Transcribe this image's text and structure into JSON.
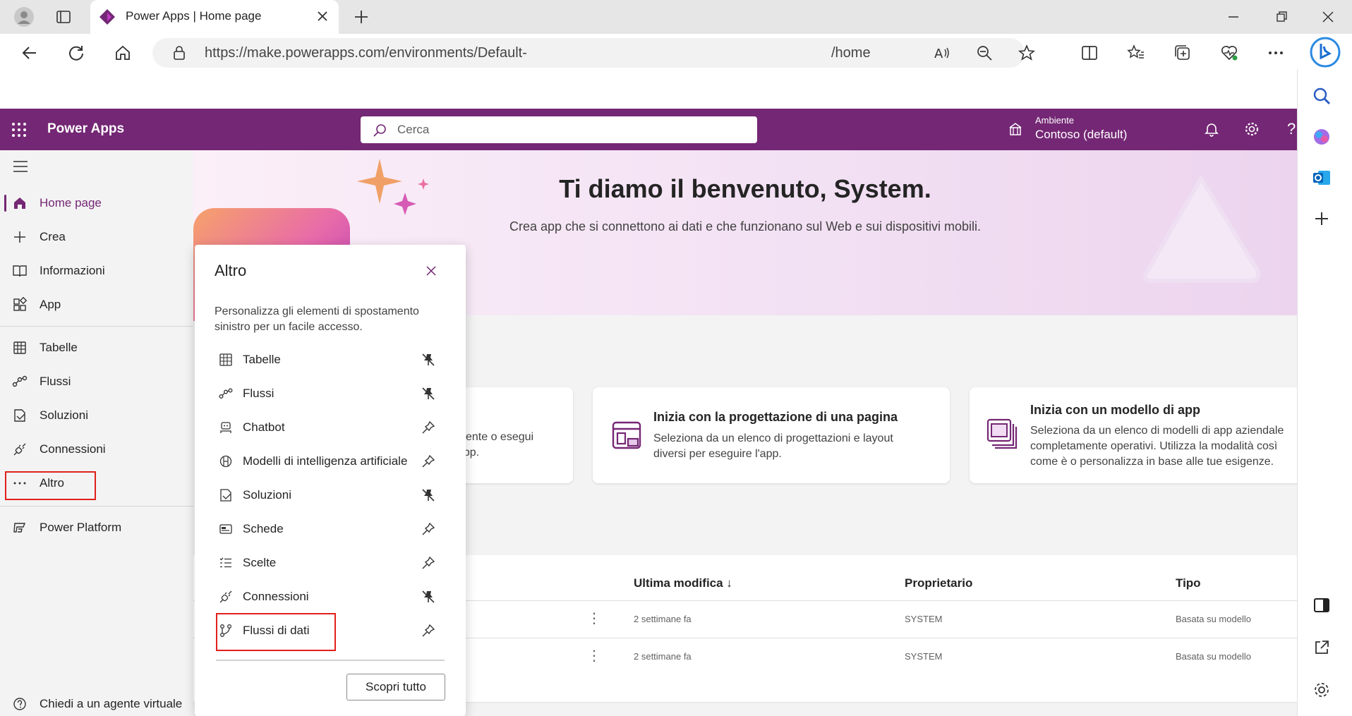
{
  "browser": {
    "tab_title": "Power Apps | Home page",
    "url_prefix": "https://make.powerapps.com/environments/Default-",
    "url_suffix": "/home"
  },
  "header": {
    "app_name": "Power Apps",
    "search_placeholder": "Cerca",
    "env_label": "Ambiente",
    "env_name": "Contoso (default)",
    "help_glyph": "?"
  },
  "nav": {
    "home": "Home page",
    "create": "Crea",
    "learn": "Informazioni",
    "apps": "App",
    "tables": "Tabelle",
    "flows": "Flussi",
    "solutions": "Soluzioni",
    "connections": "Connessioni",
    "more": "Altro",
    "platform": "Power Platform",
    "agent": "Chiedi a un agente virtuale"
  },
  "hero": {
    "title": "Ti diamo il benvenuto, System.",
    "subtitle": "Crea app che si connettono ai dati e che funzionano sul Web e sui dispositivi mobili."
  },
  "cards": [
    {
      "title": "",
      "desc_line1": "sistente o esegui",
      "desc_line2": "n'app."
    },
    {
      "title": "Inizia con la progettazione di una pagina",
      "desc_line1": "Seleziona da un elenco di progettazioni e layout",
      "desc_line2": "diversi per eseguire l'app."
    },
    {
      "title": "Inizia con un modello di app",
      "desc_line1": "Seleziona da un elenco di modelli di app aziendale",
      "desc_line2": "completamente operativi. Utilizza la modalità così",
      "desc_line3": "come è o personalizza in base alle tue esigenze."
    }
  ],
  "table": {
    "headers": {
      "modified": "Ultima modifica ↓",
      "owner": "Proprietario",
      "type": "Tipo"
    },
    "rows": [
      {
        "modified": "2 settimane fa",
        "owner": "SYSTEM",
        "type": "Basata su modello"
      },
      {
        "modified": "2 settimane fa",
        "owner": "SYSTEM",
        "type": "Basata su modello"
      }
    ],
    "more_glyph": "⋮"
  },
  "altro_panel": {
    "title": "Altro",
    "desc": "Personalizza gli elementi di spostamento sinistro per un facile accesso.",
    "items": [
      {
        "label": "Tabelle",
        "pinned": true
      },
      {
        "label": "Flussi",
        "pinned": true
      },
      {
        "label": "Chatbot",
        "pinned": false
      },
      {
        "label": "Modelli di intelligenza artificiale",
        "pinned": false
      },
      {
        "label": "Soluzioni",
        "pinned": true
      },
      {
        "label": "Schede",
        "pinned": false
      },
      {
        "label": "Scelte",
        "pinned": false
      },
      {
        "label": "Connessioni",
        "pinned": true
      },
      {
        "label": "Flussi di dati",
        "pinned": false
      }
    ],
    "discover_all": "Scopri tutto"
  },
  "colors": {
    "brand": "#742774",
    "highlight": "#e0201b"
  }
}
